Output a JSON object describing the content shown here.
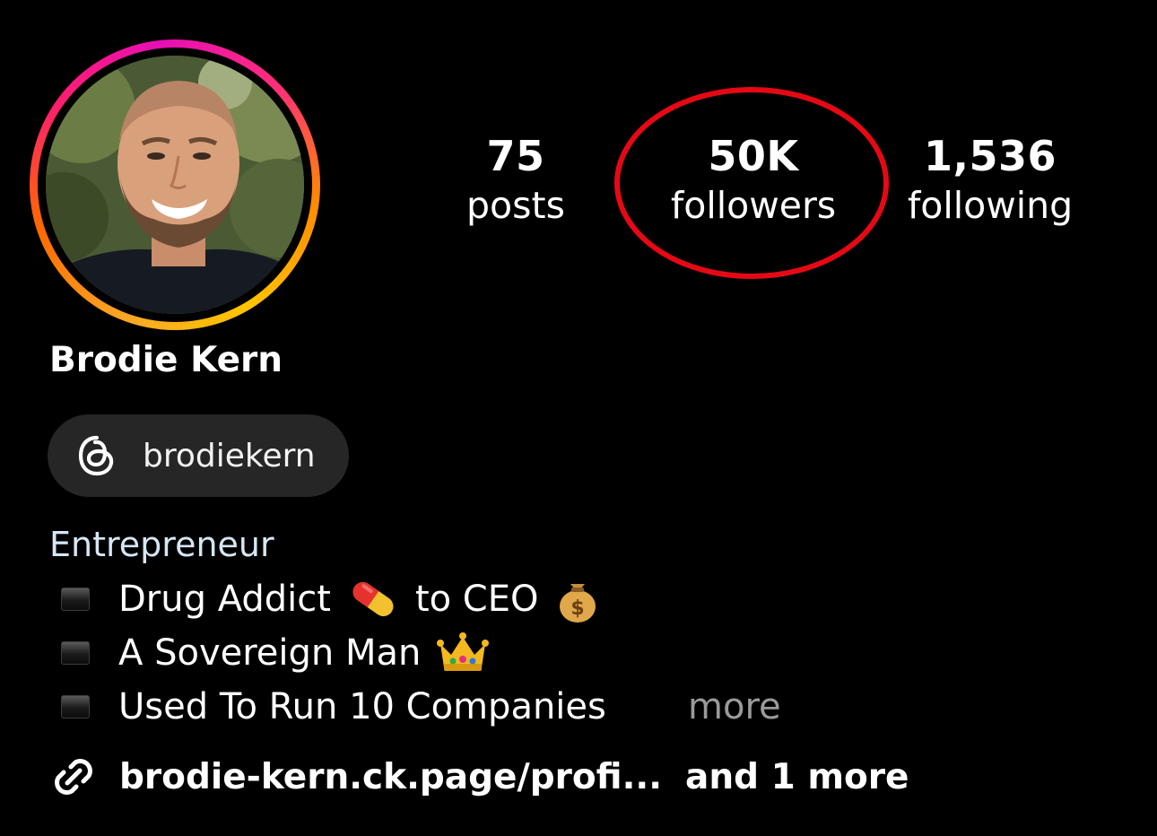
{
  "profile": {
    "name": "Brodie Kern",
    "story_ring_colors": [
      "#ffc400",
      "#ff6a00",
      "#ff1f6b",
      "#e60fb5"
    ]
  },
  "stats": {
    "posts": {
      "value": "75",
      "label": "posts"
    },
    "followers": {
      "value": "50K",
      "label": "followers"
    },
    "following": {
      "value": "1,536",
      "label": "following"
    }
  },
  "annotation": {
    "highlight": "red-ellipse-around-followers",
    "color": "#e50914"
  },
  "threads": {
    "icon": "threads-icon",
    "handle": "brodiekern"
  },
  "bio": {
    "category": "Entrepreneur",
    "lines": [
      {
        "text": "Drug Addict",
        "emoji": "pill-emoji",
        "after": "to CEO",
        "after_emoji": "money-bag-emoji"
      },
      {
        "text": "A Sovereign Man",
        "emoji": "crown-emoji"
      },
      {
        "text": "Used To Run 10 Companies"
      }
    ],
    "more": "more"
  },
  "links": {
    "icon": "link-icon",
    "url": "brodie-kern.ck.page/profi...",
    "more": "and 1 more"
  }
}
